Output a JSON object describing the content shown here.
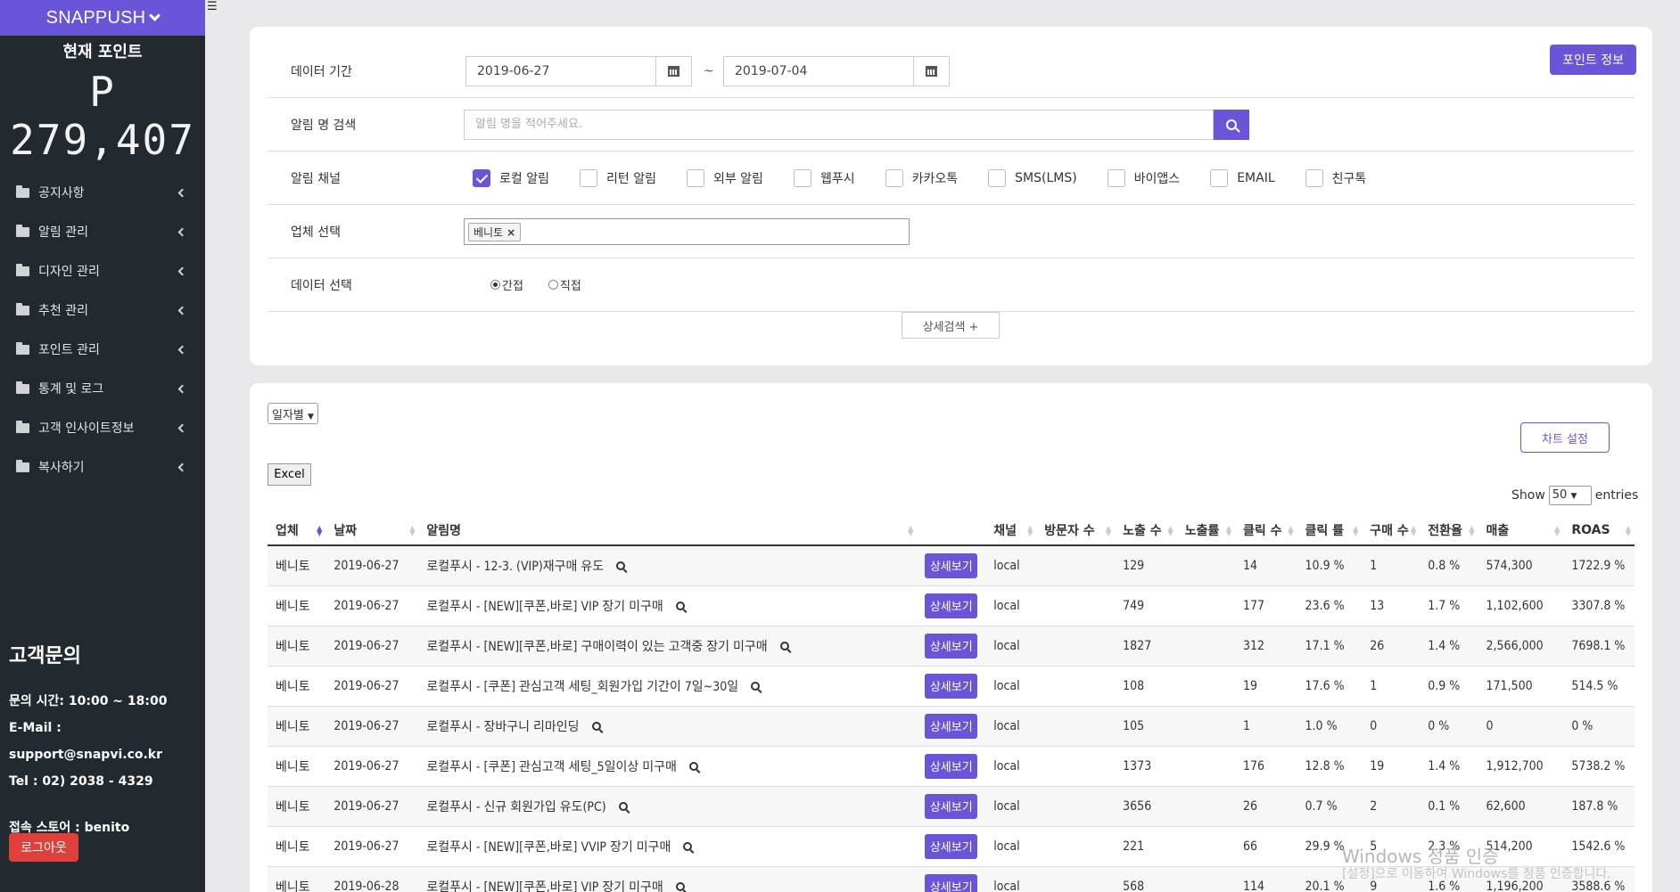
{
  "sidebar": {
    "brand": "SNAPPUSH",
    "points_label": "현재 포인트",
    "points_value": "P 279,407",
    "menu": [
      {
        "label": "공지사항"
      },
      {
        "label": "알림 관리"
      },
      {
        "label": "디자인 관리"
      },
      {
        "label": "추천 관리"
      },
      {
        "label": "포인트 관리"
      },
      {
        "label": "통계 및 로그"
      },
      {
        "label": "고객 인사이트정보"
      },
      {
        "label": "복사하기"
      }
    ],
    "contact_title": "고객문의",
    "hours": "문의 시간: 10:00 ~ 18:00",
    "email": "E-Mail : support@snapvi.co.kr",
    "tel": "Tel : 02) 2038 - 4329",
    "store": "접속 스토어 : benito",
    "logout": "로그아웃"
  },
  "filters": {
    "period_label": "데이터 기간",
    "date_from": "2019-06-27",
    "tilde": "~",
    "date_to": "2019-07-04",
    "point_info_btn": "포인트 정보",
    "search_label": "알림 명 검색",
    "search_placeholder": "알림 명을 적어주세요.",
    "channel_label": "알림 채널",
    "channels": [
      {
        "label": "로컬 알림",
        "checked": true
      },
      {
        "label": "리턴 알림",
        "checked": false
      },
      {
        "label": "외부 알림",
        "checked": false
      },
      {
        "label": "웹푸시",
        "checked": false
      },
      {
        "label": "카카오톡",
        "checked": false
      },
      {
        "label": "SMS(LMS)",
        "checked": false
      },
      {
        "label": "바이앱스",
        "checked": false
      },
      {
        "label": "EMAIL",
        "checked": false
      },
      {
        "label": "친구톡",
        "checked": false
      }
    ],
    "company_label": "업체 선택",
    "company_tag": "베니토",
    "company_tag_remove": "×",
    "data_label": "데이터 선택",
    "radio_indirect": "간접",
    "radio_direct": "직접",
    "advanced_btn": "상세검색 +"
  },
  "results": {
    "group_select": "일자별",
    "chart_btn": "차트 설정",
    "excel_btn": "Excel",
    "show": "Show",
    "entries_value": "50",
    "entries": "entries",
    "columns": [
      "업체",
      "날짜",
      "알림명",
      "",
      "채널",
      "방문자 수",
      "노출 수",
      "노출률",
      "클릭 수",
      "클릭 률",
      "구매 수",
      "전환율",
      "매출",
      "ROAS"
    ],
    "detail_label": "상세보기",
    "rows": [
      {
        "company": "베니토",
        "date": "2019-06-27",
        "name": "로컬푸시 - 12-3. (VIP)재구매 유도",
        "channel": "local",
        "visitors": "",
        "impressions": "129",
        "imp_rate": "",
        "clicks": "14",
        "click_rate": "10.9 %",
        "purchases": "1",
        "conv": "0.8 %",
        "sales": "574,300",
        "roas": "1722.9 %"
      },
      {
        "company": "베니토",
        "date": "2019-06-27",
        "name": "로컬푸시 - [NEW][쿠폰,바로] VIP 장기 미구매",
        "channel": "local",
        "visitors": "",
        "impressions": "749",
        "imp_rate": "",
        "clicks": "177",
        "click_rate": "23.6 %",
        "purchases": "13",
        "conv": "1.7 %",
        "sales": "1,102,600",
        "roas": "3307.8 %"
      },
      {
        "company": "베니토",
        "date": "2019-06-27",
        "name": "로컬푸시 - [NEW][쿠폰,바로] 구매이력이 있는 고객중 장기 미구매",
        "channel": "local",
        "visitors": "",
        "impressions": "1827",
        "imp_rate": "",
        "clicks": "312",
        "click_rate": "17.1 %",
        "purchases": "26",
        "conv": "1.4 %",
        "sales": "2,566,000",
        "roas": "7698.1 %"
      },
      {
        "company": "베니토",
        "date": "2019-06-27",
        "name": "로컬푸시 - [쿠폰] 관심고객 세팅_회원가입 기간이 7일~30일",
        "channel": "local",
        "visitors": "",
        "impressions": "108",
        "imp_rate": "",
        "clicks": "19",
        "click_rate": "17.6 %",
        "purchases": "1",
        "conv": "0.9 %",
        "sales": "171,500",
        "roas": "514.5 %"
      },
      {
        "company": "베니토",
        "date": "2019-06-27",
        "name": "로컬푸시 - 장바구니 리마인딩",
        "channel": "local",
        "visitors": "",
        "impressions": "105",
        "imp_rate": "",
        "clicks": "1",
        "click_rate": "1.0 %",
        "purchases": "0",
        "conv": "0 %",
        "sales": "0",
        "roas": "0 %"
      },
      {
        "company": "베니토",
        "date": "2019-06-27",
        "name": "로컬푸시 - [쿠폰] 관심고객 세팅_5일이상 미구매",
        "channel": "local",
        "visitors": "",
        "impressions": "1373",
        "imp_rate": "",
        "clicks": "176",
        "click_rate": "12.8 %",
        "purchases": "19",
        "conv": "1.4 %",
        "sales": "1,912,700",
        "roas": "5738.2 %"
      },
      {
        "company": "베니토",
        "date": "2019-06-27",
        "name": "로컬푸시 - 신규 회원가입 유도(PC)",
        "channel": "local",
        "visitors": "",
        "impressions": "3656",
        "imp_rate": "",
        "clicks": "26",
        "click_rate": "0.7 %",
        "purchases": "2",
        "conv": "0.1 %",
        "sales": "62,600",
        "roas": "187.8 %"
      },
      {
        "company": "베니토",
        "date": "2019-06-27",
        "name": "로컬푸시 - [NEW][쿠폰,바로] VVIP 장기 미구매",
        "channel": "local",
        "visitors": "",
        "impressions": "221",
        "imp_rate": "",
        "clicks": "66",
        "click_rate": "29.9 %",
        "purchases": "5",
        "conv": "2.3 %",
        "sales": "514,200",
        "roas": "1542.6 %"
      },
      {
        "company": "베니토",
        "date": "2019-06-28",
        "name": "로컬푸시 - [NEW][쿠폰,바로] VIP 장기 미구매",
        "channel": "local",
        "visitors": "",
        "impressions": "568",
        "imp_rate": "",
        "clicks": "114",
        "click_rate": "20.1 %",
        "purchases": "9",
        "conv": "1.6 %",
        "sales": "1,196,200",
        "roas": "3588.6 %"
      }
    ]
  },
  "watermark": {
    "title": "Windows 정품 인증",
    "subtitle": "[설정]으로 이동하여 Windows를 정품 인증합니다."
  },
  "colors": {
    "accent": "#6a55d8",
    "sidebar": "#232a2f",
    "logout": "#e0403c"
  }
}
